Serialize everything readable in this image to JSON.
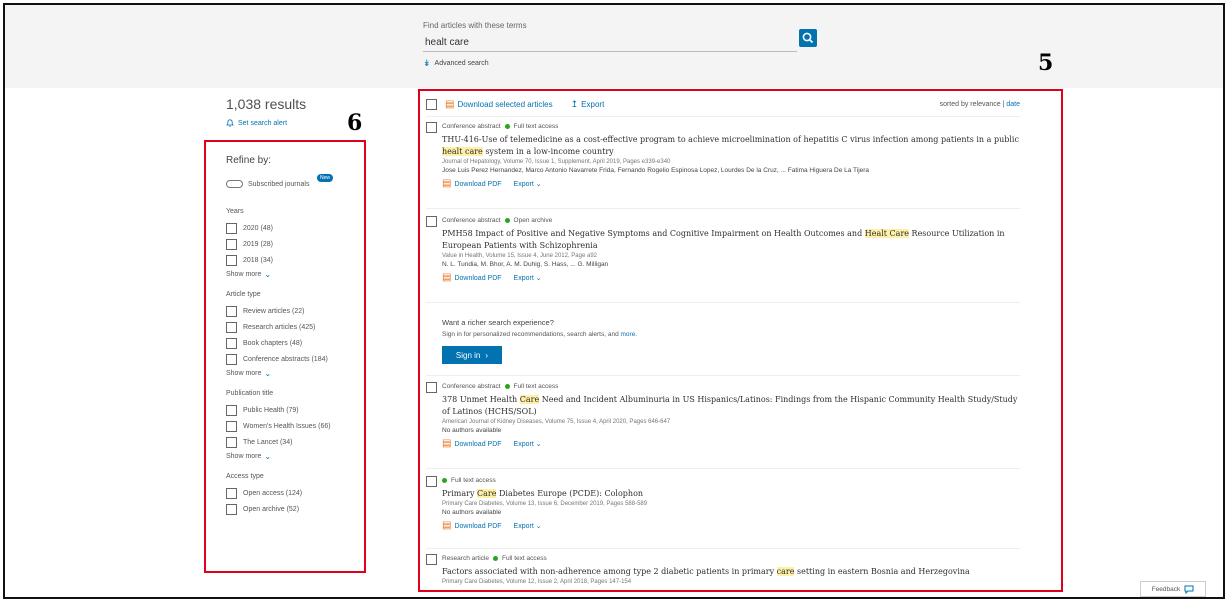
{
  "header": {
    "search_label": "Find articles with these terms",
    "search_value": "healt care",
    "advanced_search": "Advanced search"
  },
  "annotations": {
    "results_number": "5",
    "refine_number": "6"
  },
  "summary": {
    "results_count": "1,038 results",
    "set_alert": "Set search alert"
  },
  "refine": {
    "title": "Refine by:",
    "subscribed_label": "Subscribed journals",
    "new_badge": "New",
    "groups": [
      {
        "title": "Years",
        "items": [
          "2020 (48)",
          "2019 (28)",
          "2018 (34)"
        ],
        "show_more": "Show more"
      },
      {
        "title": "Article type",
        "items": [
          "Review articles (22)",
          "Research articles (425)",
          "Book chapters (48)",
          "Conference abstracts (184)"
        ],
        "show_more": "Show more"
      },
      {
        "title": "Publication title",
        "items": [
          "Public Health (79)",
          "Women's Health Issues (66)",
          "The Lancet (34)"
        ],
        "show_more": "Show more"
      },
      {
        "title": "Access type",
        "items": [
          "Open access (124)",
          "Open archive (52)"
        ]
      }
    ]
  },
  "toolbar": {
    "download_selected": "Download selected articles",
    "export": "Export",
    "sorted_by": "sorted by relevance",
    "sort_sep": " | ",
    "sort_date": "date"
  },
  "results": [
    {
      "type": "Conference abstract",
      "access": "Full text access",
      "title_parts": [
        "THU-416-Use of telemedicine as a cost-effective program to achieve microelimination of hepatitis C virus infection among patients in a public ",
        "healt care",
        " system in a low-income country"
      ],
      "journal": "Journal of Hepatology, Volume 70, Issue 1, Supplement, April 2019, Pages e339-e340",
      "authors": "Jose Luis Perez Hernandez, Marco Antonio Navarrete Frida, Fernando Rogelio Espinosa Lopez, Lourdes De la Cruz, ... Fatima Higuera De La Tijera",
      "pdf": "Download PDF",
      "export": "Export"
    },
    {
      "type": "Conference abstract",
      "access": "Open archive",
      "title_parts": [
        "PMH58 Impact of Positive and Negative Symptoms and Cognitive Impairment on Health Outcomes and ",
        "Healt Care",
        " Resource Utilization in European Patients with Schizophrenia"
      ],
      "journal": "Value in Health, Volume 15, Issue 4, June 2012, Page a92",
      "authors": "N. L. Tundia, M. Bhor, A. M. Duhig, S. Hass, ... G. Milligan",
      "pdf": "Download PDF",
      "export": "Export"
    },
    {
      "type": "Conference abstract",
      "access": "Full text access",
      "title_parts": [
        "378 Unmet Health ",
        "Care",
        " Need and Incident Albuminuria in US Hispanics/Latinos: Findings from the Hispanic Community Health Study/Study of Latinos (HCHS/SOL)"
      ],
      "journal": "American Journal of Kidney Diseases, Volume 75, Issue 4, April 2020, Pages 646-647",
      "authors": "No authors available",
      "pdf": "Download PDF",
      "export": "Export"
    },
    {
      "type": "",
      "access": "Full text access",
      "title_parts": [
        "Primary ",
        "Care",
        " Diabetes Europe (PCDE): Colophon"
      ],
      "journal": "Primary Care Diabetes, Volume 13, Issue 6, December 2019, Pages 588-589",
      "authors": "No authors available",
      "pdf": "Download PDF",
      "export": "Export"
    },
    {
      "type": "Research article",
      "access": "Full text access",
      "title_parts": [
        "Factors associated with non-adherence among type 2 diabetic patients in primary ",
        "care",
        " setting in eastern Bosnia and Herzegovina"
      ],
      "journal": "Primary Care Diabetes, Volume 12, Issue 2, April 2018, Pages 147-154",
      "authors": "",
      "pdf": "",
      "export": ""
    }
  ],
  "promo": {
    "title": "Want a richer search experience?",
    "subtitle_text": "Sign in for personalized recommendations, search alerts, and",
    "subtitle_link": "more.",
    "signin": "Sign in"
  },
  "feedback": "Feedback",
  "colors": {
    "accent": "#0272b1",
    "highlight": "#fff0a8",
    "annotation_red": "#e0001b",
    "access_green": "#29a61b"
  }
}
